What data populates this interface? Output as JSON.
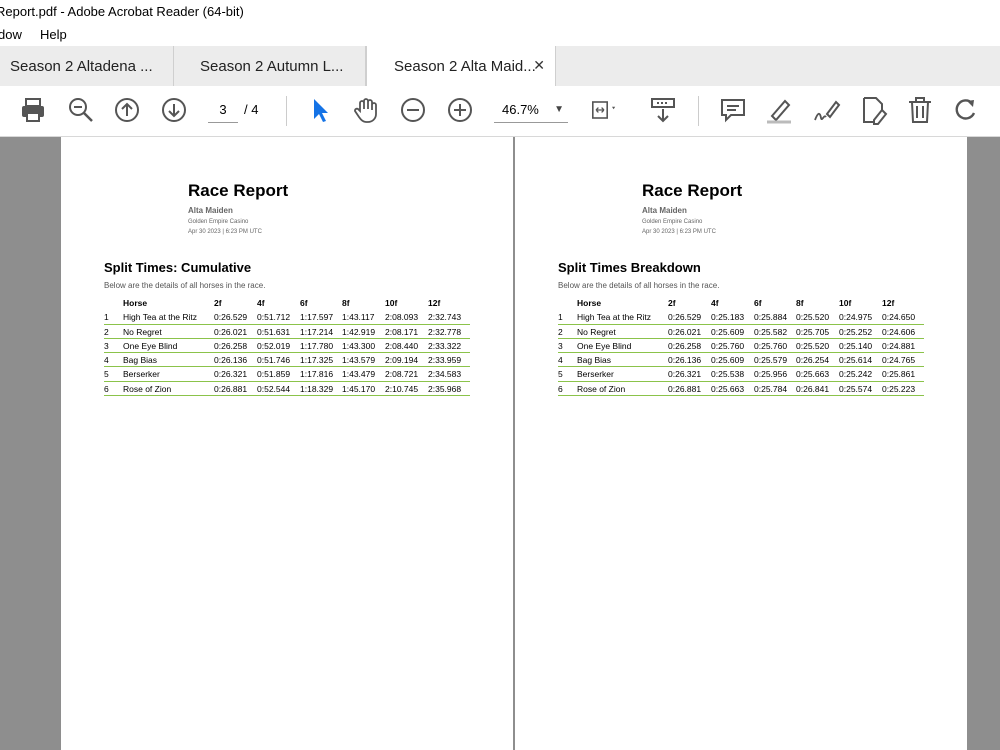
{
  "window": {
    "title": "Report.pdf - Adobe Acrobat Reader (64-bit)"
  },
  "menu": {
    "items": [
      "dow",
      "Help"
    ]
  },
  "tabs": [
    {
      "label": "Season 2 Altadena ...",
      "active": false
    },
    {
      "label": "Season 2 Autumn L...",
      "active": false
    },
    {
      "label": "Season 2 Alta Maid...",
      "active": true,
      "close": "✕"
    }
  ],
  "toolbar": {
    "page_current": "3",
    "page_total": "/ 4",
    "zoom": "46.7%",
    "icons": [
      "print-icon",
      "zoom-out-search-icon",
      "page-up-icon",
      "page-down-icon",
      "select-arrow-icon",
      "hand-icon",
      "zoom-out-icon",
      "zoom-in-icon",
      "page-fit-icon",
      "scroll-mode-icon",
      "comment-icon",
      "highlight-icon",
      "sign-icon",
      "edit-icon",
      "delete-icon",
      "rotate-icon"
    ],
    "accent": "#1473e6"
  },
  "pages": [
    {
      "report_title": "Race Report",
      "subtitle": "Alta Maiden",
      "venue": "Golden Empire Casino",
      "datetime": "Apr 30 2023 | 6:23 PM UTC",
      "heading": "Split Times: Cumulative",
      "description": "Below are the details of all horses in the race.",
      "columns": [
        "",
        "Horse",
        "2f",
        "4f",
        "6f",
        "8f",
        "10f",
        "12f"
      ],
      "rows": [
        [
          "1",
          "High Tea at the Ritz",
          "0:26.529",
          "0:51.712",
          "1:17.597",
          "1:43.117",
          "2:08.093",
          "2:32.743"
        ],
        [
          "2",
          "No Regret",
          "0:26.021",
          "0:51.631",
          "1:17.214",
          "1:42.919",
          "2:08.171",
          "2:32.778"
        ],
        [
          "3",
          "One Eye Blind",
          "0:26.258",
          "0:52.019",
          "1:17.780",
          "1:43.300",
          "2:08.440",
          "2:33.322"
        ],
        [
          "4",
          "Bag Bias",
          "0:26.136",
          "0:51.746",
          "1:17.325",
          "1:43.579",
          "2:09.194",
          "2:33.959"
        ],
        [
          "5",
          "Berserker",
          "0:26.321",
          "0:51.859",
          "1:17.816",
          "1:43.479",
          "2:08.721",
          "2:34.583"
        ],
        [
          "6",
          "Rose of Zion",
          "0:26.881",
          "0:52.544",
          "1:18.329",
          "1:45.170",
          "2:10.745",
          "2:35.968"
        ]
      ]
    },
    {
      "report_title": "Race Report",
      "subtitle": "Alta Maiden",
      "venue": "Golden Empire Casino",
      "datetime": "Apr 30 2023 | 6:23 PM UTC",
      "heading": "Split Times Breakdown",
      "description": "Below are the details of all horses in the race.",
      "columns": [
        "",
        "Horse",
        "2f",
        "4f",
        "6f",
        "8f",
        "10f",
        "12f"
      ],
      "rows": [
        [
          "1",
          "High Tea at the Ritz",
          "0:26.529",
          "0:25.183",
          "0:25.884",
          "0:25.520",
          "0:24.975",
          "0:24.650"
        ],
        [
          "2",
          "No Regret",
          "0:26.021",
          "0:25.609",
          "0:25.582",
          "0:25.705",
          "0:25.252",
          "0:24.606"
        ],
        [
          "3",
          "One Eye Blind",
          "0:26.258",
          "0:25.760",
          "0:25.760",
          "0:25.520",
          "0:25.140",
          "0:24.881"
        ],
        [
          "4",
          "Bag Bias",
          "0:26.136",
          "0:25.609",
          "0:25.579",
          "0:26.254",
          "0:25.614",
          "0:24.765"
        ],
        [
          "5",
          "Berserker",
          "0:26.321",
          "0:25.538",
          "0:25.956",
          "0:25.663",
          "0:25.242",
          "0:25.861"
        ],
        [
          "6",
          "Rose of Zion",
          "0:26.881",
          "0:25.663",
          "0:25.784",
          "0:26.841",
          "0:25.574",
          "0:25.223"
        ]
      ]
    }
  ]
}
